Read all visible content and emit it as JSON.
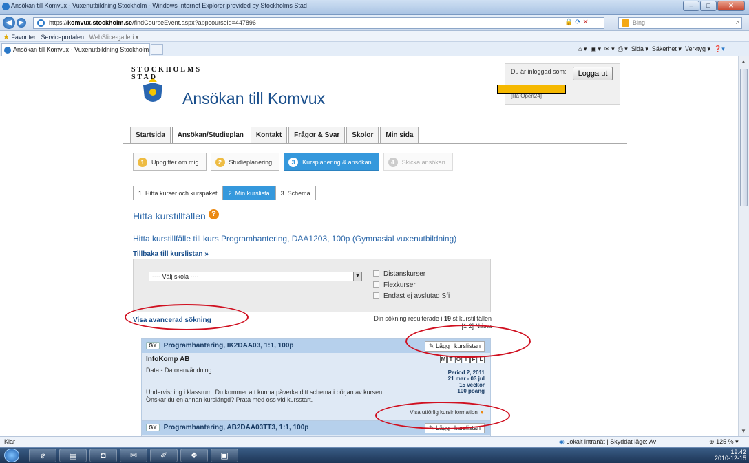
{
  "window": {
    "title": "Ansökan till Komvux - Vuxenutbildning Stockholm - Windows Internet Explorer provided by Stockholms Stad"
  },
  "address": {
    "prefix": "https://",
    "host": "komvux.stockholm.se",
    "path": "/findCourseEvent.aspx?appcourseid=447896"
  },
  "search": {
    "placeholder": "Bing"
  },
  "favorites": {
    "label": "Favoriter",
    "items": [
      "Serviceportalen",
      "WebSlice-galleri ▾"
    ]
  },
  "tab": {
    "title": "Ansökan till Komvux - Vuxenutbildning Stockholm"
  },
  "commands": {
    "sida": "Sida ▾",
    "sakerhet": "Säkerhet ▾",
    "verktyg": "Verktyg ▾"
  },
  "site": {
    "brand": "Ansökan till Komvux",
    "logo_text": "STOCKHOLMS STAD"
  },
  "login": {
    "label": "Du är inloggad som:",
    "logout": "Logga ut",
    "user": "[lila Open24]"
  },
  "main_tabs": [
    "Startsida",
    "Ansökan/Studieplan",
    "Kontakt",
    "Frågor & Svar",
    "Skolor",
    "Min sida"
  ],
  "steps": [
    {
      "num": "1",
      "label": "Uppgifter om mig"
    },
    {
      "num": "2",
      "label": "Studieplanering"
    },
    {
      "num": "3",
      "label": "Kursplanering & ansökan"
    },
    {
      "num": "4",
      "label": "Skicka ansökan"
    }
  ],
  "sub_tabs": [
    "1. Hitta kurser och kurspaket",
    "2. Min kurslista",
    "3. Schema"
  ],
  "heading": "Hitta kurstillfällen",
  "subheading": "Hitta kurstillfälle till kurs Programhantering, DAA1203, 100p (Gymnasial vuxenutbildning)",
  "back_link": "Tillbaka till kurslistan »",
  "filter": {
    "school_select": "---- Välj skola ----",
    "checkboxes": [
      "Distanskurser",
      "Flexkurser",
      "Endast ej avslutad Sfi"
    ]
  },
  "advanced": "Visa avancerad sökning",
  "results": {
    "pre": "Din sökning resulterade i",
    "count": "19",
    "post": "st kurstillfällen",
    "pager": "[1 2] Nästa"
  },
  "cards": [
    {
      "level": "GY",
      "title": "Programhantering, IK2DAA03, 1:1, 100p",
      "add": "Lägg i kurslistan",
      "school": "InfoKomp AB",
      "subject": "Data - Datoranvändning",
      "desc1": "Undervisning i klassrum. Du kommer att kunna påverka ditt schema i början av kursen.",
      "desc2": "Önskar du en annan kurslängd? Prata med oss vid kursstart.",
      "days": [
        "M",
        "T",
        "O",
        "T",
        "F",
        "L"
      ],
      "period": "Period 2, 2011",
      "dates": "21 mar - 03 jul",
      "weeks": "15 veckor",
      "points": "100 poäng",
      "more": "Visa utförlig kursinformation"
    },
    {
      "level": "GY",
      "title": "Programhantering, AB2DAA03TT3, 1:1, 100p",
      "add": "Lägg i kurslistan"
    }
  ],
  "status": {
    "left": "Klar",
    "zone": "Lokalt intranät | Skyddat läge: Av",
    "zoom": "125 %"
  },
  "clock": {
    "time": "19:42",
    "date": "2010-12-15"
  }
}
